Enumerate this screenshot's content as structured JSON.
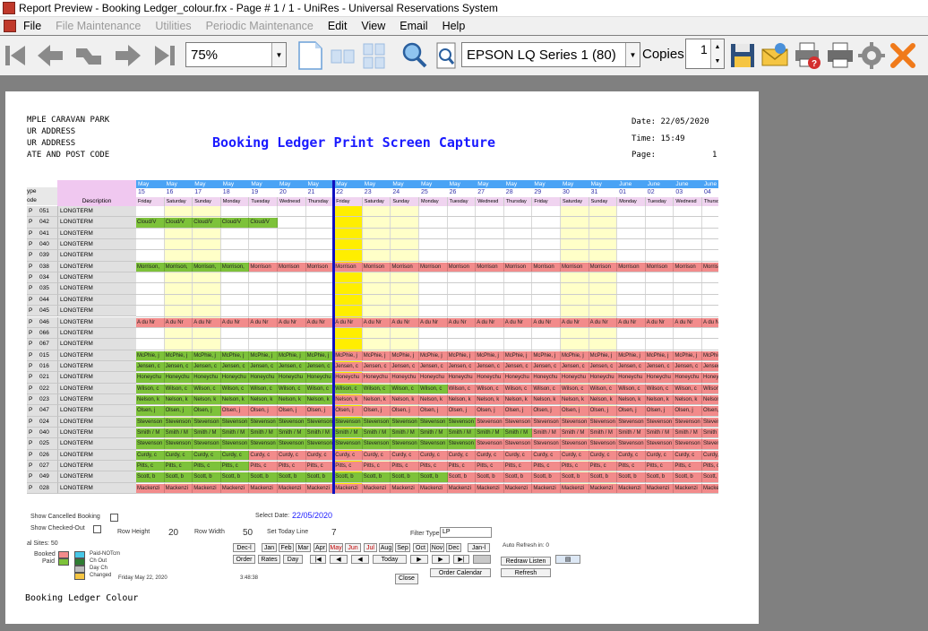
{
  "window": {
    "title": "Report Preview - Booking Ledger_colour.frx - Page # 1 / 1 - UniRes - Universal Reservations System"
  },
  "menu": [
    {
      "label": "File",
      "disabled": false
    },
    {
      "label": "File Maintenance",
      "disabled": true
    },
    {
      "label": "Utilities",
      "disabled": true
    },
    {
      "label": "Periodic Maintenance",
      "disabled": true
    },
    {
      "label": "Edit",
      "disabled": false
    },
    {
      "label": "View",
      "disabled": false
    },
    {
      "label": "Email",
      "disabled": false
    },
    {
      "label": "Help",
      "disabled": false
    }
  ],
  "toolbar": {
    "zoom": "75%",
    "printer": "EPSON LQ Series 1 (80)",
    "copies_label": "Copies",
    "copies_value": "1",
    "icons": [
      "first-page-icon",
      "prev-page-icon",
      "goto-page-icon",
      "next-page-icon",
      "last-page-icon",
      "single-page-icon",
      "two-pages-icon",
      "four-pages-icon",
      "zoom-icon",
      "find-icon",
      "save-icon",
      "email-icon",
      "print-options-icon",
      "print-icon",
      "settings-icon",
      "close-icon"
    ]
  },
  "report": {
    "header_lines": [
      "MPLE CARAVAN PARK",
      "UR ADDRESS",
      "UR ADDRESS",
      "ATE AND POST CODE"
    ],
    "title": "Booking Ledger Print Screen Capture",
    "date": "Date: 22/05/2020",
    "time": "Time: 15:49",
    "page_label": "Page:",
    "page_num": "1",
    "footer": "Booking Ledger Colour",
    "col_type": "ype",
    "col_code": "ode",
    "col_desc": "Description",
    "days": [
      {
        "m": "May",
        "d": "15",
        "w": "Friday"
      },
      {
        "m": "May",
        "d": "16",
        "w": "Saturday"
      },
      {
        "m": "May",
        "d": "17",
        "w": "Sunday"
      },
      {
        "m": "May",
        "d": "18",
        "w": "Monday"
      },
      {
        "m": "May",
        "d": "19",
        "w": "Tuesday"
      },
      {
        "m": "May",
        "d": "20",
        "w": "Wednesd"
      },
      {
        "m": "May",
        "d": "21",
        "w": "Thursday"
      },
      {
        "m": "May",
        "d": "22",
        "w": "Friday"
      },
      {
        "m": "May",
        "d": "23",
        "w": "Saturday"
      },
      {
        "m": "May",
        "d": "24",
        "w": "Sunday"
      },
      {
        "m": "May",
        "d": "25",
        "w": "Monday"
      },
      {
        "m": "May",
        "d": "26",
        "w": "Tuesday"
      },
      {
        "m": "May",
        "d": "27",
        "w": "Wednesd"
      },
      {
        "m": "May",
        "d": "28",
        "w": "Thursday"
      },
      {
        "m": "May",
        "d": "29",
        "w": "Friday"
      },
      {
        "m": "May",
        "d": "30",
        "w": "Saturday"
      },
      {
        "m": "May",
        "d": "31",
        "w": "Sunday"
      },
      {
        "m": "June",
        "d": "01",
        "w": "Monday"
      },
      {
        "m": "June",
        "d": "02",
        "w": "Tuesday"
      },
      {
        "m": "June",
        "d": "03",
        "w": "Wednesd"
      },
      {
        "m": "June",
        "d": "04",
        "w": "Thursd"
      }
    ],
    "weekend_cols": [
      1,
      2,
      8,
      9,
      15,
      16
    ],
    "today_col": 7,
    "colors": {
      "green": "#7dc23a",
      "red": "#f28b8b",
      "weekend": "#ffffc8",
      "today": "#ffee00",
      "header": "#4aa3f5",
      "desc": "#f0c8f0"
    },
    "rows": [
      {
        "t": "P",
        "c": "051",
        "d": "LONGTERM",
        "segs": []
      },
      {
        "t": "P",
        "c": "042",
        "d": "LONGTERM",
        "segs": [
          {
            "from": 0,
            "to": 5,
            "color": "green",
            "text": "Cloud/V"
          }
        ]
      },
      {
        "t": "P",
        "c": "041",
        "d": "LONGTERM",
        "segs": []
      },
      {
        "t": "P",
        "c": "040",
        "d": "LONGTERM",
        "segs": []
      },
      {
        "t": "P",
        "c": "039",
        "d": "LONGTERM",
        "segs": []
      },
      {
        "t": "P",
        "c": "038",
        "d": "LONGTERM",
        "segs": [
          {
            "from": 0,
            "to": 4,
            "color": "green",
            "text": "Morrison,"
          },
          {
            "from": 4,
            "to": 21,
            "color": "red",
            "text": "Morrison"
          }
        ]
      },
      {
        "t": "P",
        "c": "034",
        "d": "LONGTERM",
        "segs": []
      },
      {
        "t": "P",
        "c": "035",
        "d": "LONGTERM",
        "segs": []
      },
      {
        "t": "P",
        "c": "044",
        "d": "LONGTERM",
        "segs": []
      },
      {
        "t": "P",
        "c": "045",
        "d": "LONGTERM",
        "segs": []
      },
      {
        "t": "P",
        "c": "046",
        "d": "LONGTERM",
        "segs": [
          {
            "from": 0,
            "to": 21,
            "color": "red",
            "text": "A du Nr"
          }
        ]
      },
      {
        "t": "P",
        "c": "066",
        "d": "LONGTERM",
        "segs": []
      },
      {
        "t": "P",
        "c": "067",
        "d": "LONGTERM",
        "segs": []
      },
      {
        "t": "P",
        "c": "015",
        "d": "LONGTERM",
        "segs": [
          {
            "from": 0,
            "to": 7,
            "color": "green",
            "text": "McPhie, j"
          },
          {
            "from": 7,
            "to": 21,
            "color": "red",
            "text": "McPhie, j"
          }
        ]
      },
      {
        "t": "P",
        "c": "016",
        "d": "LONGTERM",
        "segs": [
          {
            "from": 0,
            "to": 7,
            "color": "green",
            "text": "Jensen, c"
          },
          {
            "from": 7,
            "to": 21,
            "color": "red",
            "text": "Jensen, c"
          }
        ]
      },
      {
        "t": "P",
        "c": "021",
        "d": "LONGTERM",
        "segs": [
          {
            "from": 0,
            "to": 7,
            "color": "green",
            "text": "Honeychu"
          },
          {
            "from": 7,
            "to": 21,
            "color": "red",
            "text": "Honeychu"
          }
        ]
      },
      {
        "t": "P",
        "c": "022",
        "d": "LONGTERM",
        "segs": [
          {
            "from": 0,
            "to": 11,
            "color": "green",
            "text": "Wilson, c"
          },
          {
            "from": 11,
            "to": 21,
            "color": "red",
            "text": "Wilson, c"
          }
        ]
      },
      {
        "t": "P",
        "c": "023",
        "d": "LONGTERM",
        "segs": [
          {
            "from": 0,
            "to": 7,
            "color": "green",
            "text": "Nelson, k"
          },
          {
            "from": 7,
            "to": 21,
            "color": "red",
            "text": "Nelson, k"
          }
        ]
      },
      {
        "t": "P",
        "c": "047",
        "d": "LONGTERM",
        "segs": [
          {
            "from": 0,
            "to": 3,
            "color": "green",
            "text": "Olsen, j"
          },
          {
            "from": 3,
            "to": 21,
            "color": "red",
            "text": "Olsen, j"
          }
        ]
      },
      {
        "t": "P",
        "c": "024",
        "d": "LONGTERM",
        "segs": [
          {
            "from": 0,
            "to": 12,
            "color": "green",
            "text": "Stevenson"
          },
          {
            "from": 12,
            "to": 21,
            "color": "red",
            "text": "Stevenson"
          }
        ]
      },
      {
        "t": "P",
        "c": "040",
        "d": "LONGTERM",
        "segs": [
          {
            "from": 0,
            "to": 14,
            "color": "green",
            "text": "Smith / M"
          },
          {
            "from": 14,
            "to": 21,
            "color": "red",
            "text": "Smith / M"
          }
        ]
      },
      {
        "t": "P",
        "c": "025",
        "d": "LONGTERM",
        "segs": [
          {
            "from": 0,
            "to": 12,
            "color": "green",
            "text": "Stevenson"
          },
          {
            "from": 12,
            "to": 21,
            "color": "red",
            "text": "Stevenson"
          }
        ]
      },
      {
        "t": "P",
        "c": "026",
        "d": "LONGTERM",
        "segs": [
          {
            "from": 0,
            "to": 4,
            "color": "green",
            "text": "Curdy, c"
          },
          {
            "from": 4,
            "to": 21,
            "color": "red",
            "text": "Curdy, c"
          }
        ]
      },
      {
        "t": "P",
        "c": "027",
        "d": "LONGTERM",
        "segs": [
          {
            "from": 0,
            "to": 4,
            "color": "green",
            "text": "Pitts, c"
          },
          {
            "from": 4,
            "to": 21,
            "color": "red",
            "text": "Pitts, c"
          }
        ]
      },
      {
        "t": "P",
        "c": "049",
        "d": "LONGTERM",
        "segs": [
          {
            "from": 0,
            "to": 11,
            "color": "green",
            "text": "Scott, b"
          },
          {
            "from": 11,
            "to": 21,
            "color": "red",
            "text": "Scott, b"
          }
        ]
      },
      {
        "t": "P",
        "c": "028",
        "d": "LONGTERM",
        "segs": [
          {
            "from": 0,
            "to": 21,
            "color": "red",
            "text": "Mackenzi"
          }
        ]
      }
    ]
  },
  "controls": {
    "show_cancelled": "Show Cancelled Booking",
    "show_checked_out": "Show Checked-Out",
    "row_height_label": "Row Height",
    "row_height": "20",
    "row_width_label": "Row Width",
    "row_width": "50",
    "set_today_label": "Set Today Line",
    "set_today": "7",
    "select_date_label": "Select Date:",
    "select_date": "22/05/2020",
    "filter_label": "Filter Type",
    "filter_value": "LP",
    "total_sites": "al Sites: 50",
    "months": [
      "Dec-l",
      "Jan",
      "Feb",
      "Mar",
      "Apr",
      "May",
      "Jun",
      "Jul",
      "Aug",
      "Sep",
      "Oct",
      "Nov",
      "Dec",
      "Jan-l"
    ],
    "order": "Order",
    "rates": "Rates",
    "day": "Day",
    "today": "Today",
    "order_calendar": "Order Calendar",
    "close": "Close",
    "auto_refresh": "Auto Refresh in: 0",
    "redraw": "Redraw Listen",
    "refresh": "Refresh",
    "legend_booked": "Booked",
    "legend_paid": "Paid",
    "legend_items": [
      "Paid-NOTcm",
      "Ch Out",
      "Day Ch",
      "Changed"
    ],
    "printed_date": "Friday May 22, 2020",
    "printed_time": "3:48:38"
  }
}
